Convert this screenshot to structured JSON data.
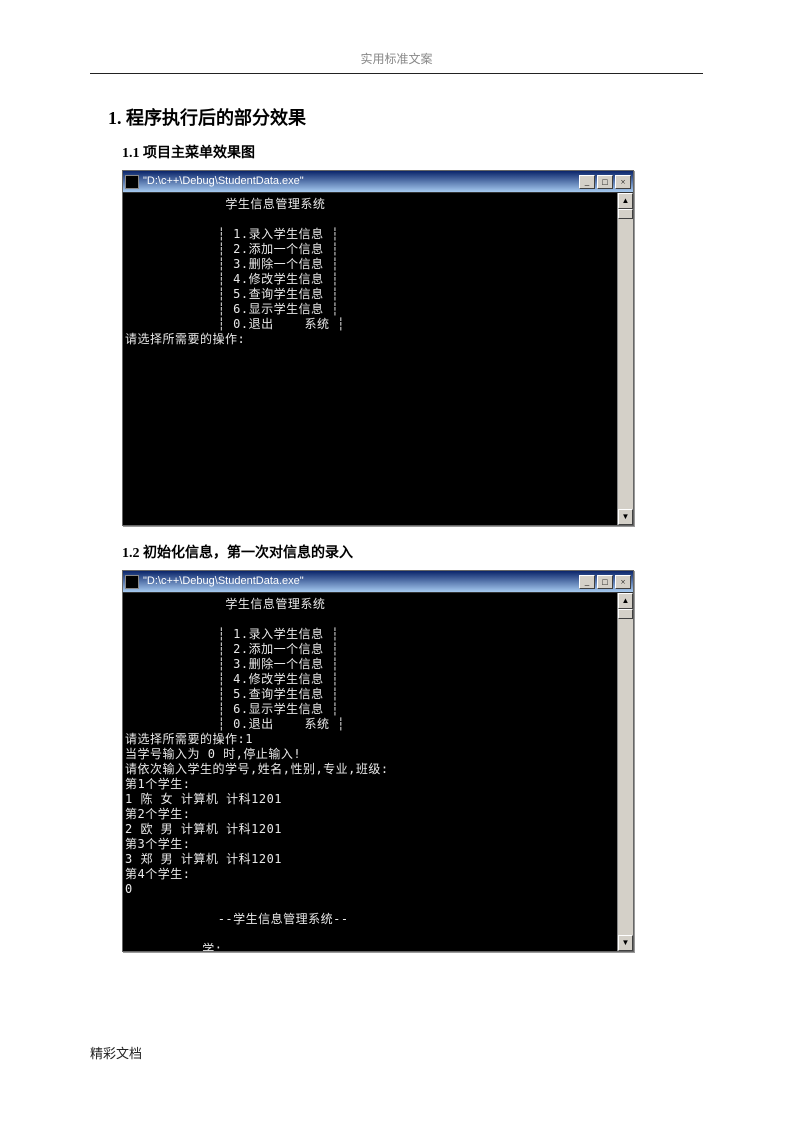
{
  "header": {
    "running": "实用标准文案"
  },
  "h1": "1. 程序执行后的部分效果",
  "s1": {
    "title": "1.1 项目主菜单效果图"
  },
  "s2": {
    "title": "1.2 初始化信息，第一次对信息的录入"
  },
  "win": {
    "title": "\"D:\\c++\\Debug\\StudentData.exe\"",
    "btn_min": "_",
    "btn_max": "□",
    "btn_close": "×",
    "sb_up": "▲",
    "sb_down": "▼"
  },
  "c1": {
    "l0": "             学生信息管理系统",
    "l1": "            ┆ 1.录入学生信息 ┆",
    "l2": "            ┆ 2.添加一个信息 ┆",
    "l3": "            ┆ 3.删除一个信息 ┆",
    "l4": "            ┆ 4.修改学生信息 ┆",
    "l5": "            ┆ 5.查询学生信息 ┆",
    "l6": "            ┆ 6.显示学生信息 ┆",
    "l7": "            ┆ 0.退出    系统 ┆",
    "l8": "请选择所需要的操作:"
  },
  "c2": {
    "l0": "             学生信息管理系统",
    "l1": "            ┆ 1.录入学生信息 ┆",
    "l2": "            ┆ 2.添加一个信息 ┆",
    "l3": "            ┆ 3.删除一个信息 ┆",
    "l4": "            ┆ 4.修改学生信息 ┆",
    "l5": "            ┆ 5.查询学生信息 ┆",
    "l6": "            ┆ 6.显示学生信息 ┆",
    "l7": "            ┆ 0.退出    系统 ┆",
    "l8": "请选择所需要的操作:1",
    "l9": "当学号输入为 0 时,停止输入!",
    "l10": "请依次输入学生的学号,姓名,性别,专业,班级:",
    "l11": "第1个学生:",
    "l12": "1 陈 女 计算机 计科1201",
    "l13": "第2个学生:",
    "l14": "2 欧 男 计算机 计科1201",
    "l15": "第3个学生:",
    "l16": "3 郑 男 计算机 计科1201",
    "l17": "第4个学生:",
    "l18": "0",
    "l19": "",
    "l20": "            --学生信息管理系统--",
    "l21": "",
    "l22": "          学:"
  },
  "footer": "精彩文档"
}
